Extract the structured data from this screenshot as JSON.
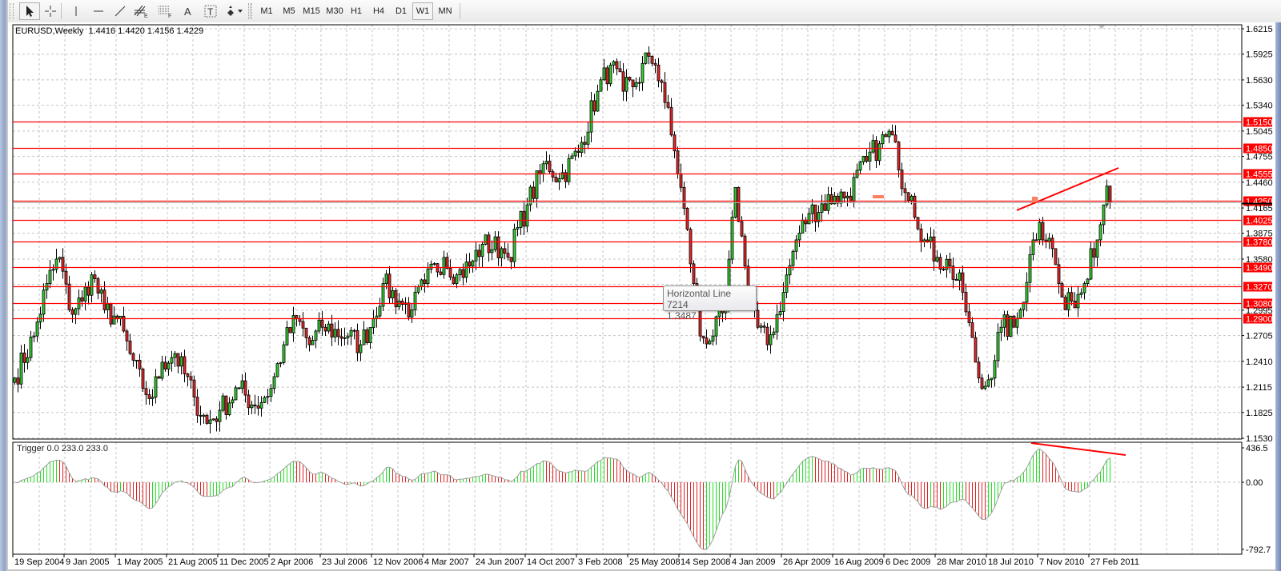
{
  "toolbar": {
    "tools": [
      {
        "name": "cursor",
        "icon": "arrow-cursor-icon"
      },
      {
        "name": "crosshair",
        "icon": "crosshair-icon"
      },
      {
        "name": "vertical-line",
        "icon": "vertical-line-icon"
      },
      {
        "name": "horizontal-line",
        "icon": "horizontal-line-icon"
      },
      {
        "name": "trendline",
        "icon": "trendline-icon"
      },
      {
        "name": "equidistant-channel",
        "icon": "channel-icon",
        "label": "E"
      },
      {
        "name": "fibonacci",
        "icon": "fibonacci-icon",
        "label": "F"
      },
      {
        "name": "text",
        "icon": "text-icon",
        "label": "A"
      },
      {
        "name": "text-label",
        "icon": "text-label-icon",
        "label": "T"
      },
      {
        "name": "arrows",
        "icon": "arrows-dropdown-icon"
      }
    ],
    "timeframes": [
      "M1",
      "M5",
      "M15",
      "M30",
      "H1",
      "H4",
      "D1",
      "W1",
      "MN"
    ],
    "active_timeframe": "W1"
  },
  "chart": {
    "header": "EURUSD,Weekly  1.4416 1.4420 1.4156 1.4229",
    "symbol": "EURUSD",
    "period": "Weekly",
    "ohlc": {
      "open": 1.4416,
      "high": 1.442,
      "low": 1.4156,
      "close": 1.4229
    },
    "price_axis": [
      "1.6215",
      "1.5925",
      "1.5630",
      "1.5340",
      "1.5045",
      "1.4755",
      "1.4460",
      "1.4165",
      "1.3875",
      "1.3580",
      "1.2995",
      "1.2705",
      "1.2410",
      "1.2115",
      "1.1825",
      "1.1530"
    ],
    "horizontal_lines": [
      "1.5150",
      "1.4850",
      "1.4555",
      "1.4250",
      "1.4025",
      "1.3780",
      "1.3490",
      "1.3270",
      "1.3080",
      "1.2900"
    ],
    "line_color": "#ff0000",
    "bull_color": "#32cd32",
    "bear_color": "#e0282a",
    "time_axis": [
      "19 Sep 2004",
      "9 Jan 2005",
      "1 May 2005",
      "21 Aug 2005",
      "11 Dec 2005",
      "2 Apr 2006",
      "23 Jul 2006",
      "12 Nov 2006",
      "4 Mar 2007",
      "24 Jun 2007",
      "14 Oct 2007",
      "3 Feb 2008",
      "25 May 2008",
      "14 Sep 2008",
      "4 Jan 2009",
      "26 Apr 2009",
      "16 Aug 2009",
      "6 Dec 2009",
      "28 Mar 2010",
      "18 Jul 2010",
      "7 Nov 2010",
      "27 Feb 2011"
    ],
    "close_waypoints": [
      [
        0,
        1.222
      ],
      [
        6,
        1.27
      ],
      [
        10,
        1.33
      ],
      [
        14,
        1.36
      ],
      [
        17,
        1.3
      ],
      [
        21,
        1.31
      ],
      [
        24,
        1.34
      ],
      [
        28,
        1.3
      ],
      [
        32,
        1.29
      ],
      [
        36,
        1.25
      ],
      [
        40,
        1.21
      ],
      [
        43,
        1.2
      ],
      [
        46,
        1.24
      ],
      [
        50,
        1.25
      ],
      [
        56,
        1.2
      ],
      [
        60,
        1.17
      ],
      [
        64,
        1.185
      ],
      [
        70,
        1.21
      ],
      [
        75,
        1.19
      ],
      [
        80,
        1.21
      ],
      [
        84,
        1.26
      ],
      [
        88,
        1.29
      ],
      [
        92,
        1.26
      ],
      [
        96,
        1.28
      ],
      [
        104,
        1.27
      ],
      [
        108,
        1.26
      ],
      [
        112,
        1.29
      ],
      [
        115,
        1.33
      ],
      [
        120,
        1.31
      ],
      [
        124,
        1.3
      ],
      [
        128,
        1.33
      ],
      [
        134,
        1.36
      ],
      [
        138,
        1.34
      ],
      [
        142,
        1.35
      ],
      [
        146,
        1.375
      ],
      [
        152,
        1.37
      ],
      [
        154,
        1.36
      ],
      [
        160,
        1.42
      ],
      [
        166,
        1.47
      ],
      [
        170,
        1.45
      ],
      [
        176,
        1.48
      ],
      [
        182,
        1.55
      ],
      [
        186,
        1.58
      ],
      [
        190,
        1.55
      ],
      [
        194,
        1.56
      ],
      [
        198,
        1.59
      ],
      [
        200,
        1.58
      ],
      [
        202,
        1.56
      ],
      [
        205,
        1.5
      ],
      [
        208,
        1.44
      ],
      [
        212,
        1.33
      ],
      [
        214,
        1.27
      ],
      [
        218,
        1.27
      ],
      [
        222,
        1.3
      ],
      [
        225,
        1.44
      ],
      [
        228,
        1.35
      ],
      [
        232,
        1.28
      ],
      [
        235,
        1.26
      ],
      [
        240,
        1.32
      ],
      [
        244,
        1.38
      ],
      [
        248,
        1.41
      ],
      [
        256,
        1.43
      ],
      [
        260,
        1.43
      ],
      [
        266,
        1.47
      ],
      [
        270,
        1.49
      ],
      [
        274,
        1.5
      ],
      [
        276,
        1.46
      ],
      [
        280,
        1.43
      ],
      [
        284,
        1.38
      ],
      [
        288,
        1.36
      ],
      [
        292,
        1.35
      ],
      [
        296,
        1.32
      ],
      [
        300,
        1.24
      ],
      [
        302,
        1.21
      ],
      [
        304,
        1.22
      ],
      [
        308,
        1.28
      ],
      [
        312,
        1.28
      ],
      [
        314,
        1.3
      ],
      [
        318,
        1.38
      ],
      [
        320,
        1.4
      ],
      [
        324,
        1.37
      ],
      [
        326,
        1.33
      ],
      [
        328,
        1.3
      ],
      [
        330,
        1.31
      ],
      [
        334,
        1.33
      ],
      [
        336,
        1.37
      ],
      [
        338,
        1.38
      ],
      [
        340,
        1.42
      ],
      [
        341,
        1.4416
      ],
      [
        342,
        1.4229
      ]
    ]
  },
  "indicator": {
    "label": "Trigger 0.0 233.0 233.0",
    "axis": [
      "436.5",
      "0.00",
      "-792.7"
    ],
    "max": 436.5,
    "min": -792.7
  },
  "tooltip": {
    "title": "Horizontal Line 7214",
    "value": "1.3487"
  }
}
